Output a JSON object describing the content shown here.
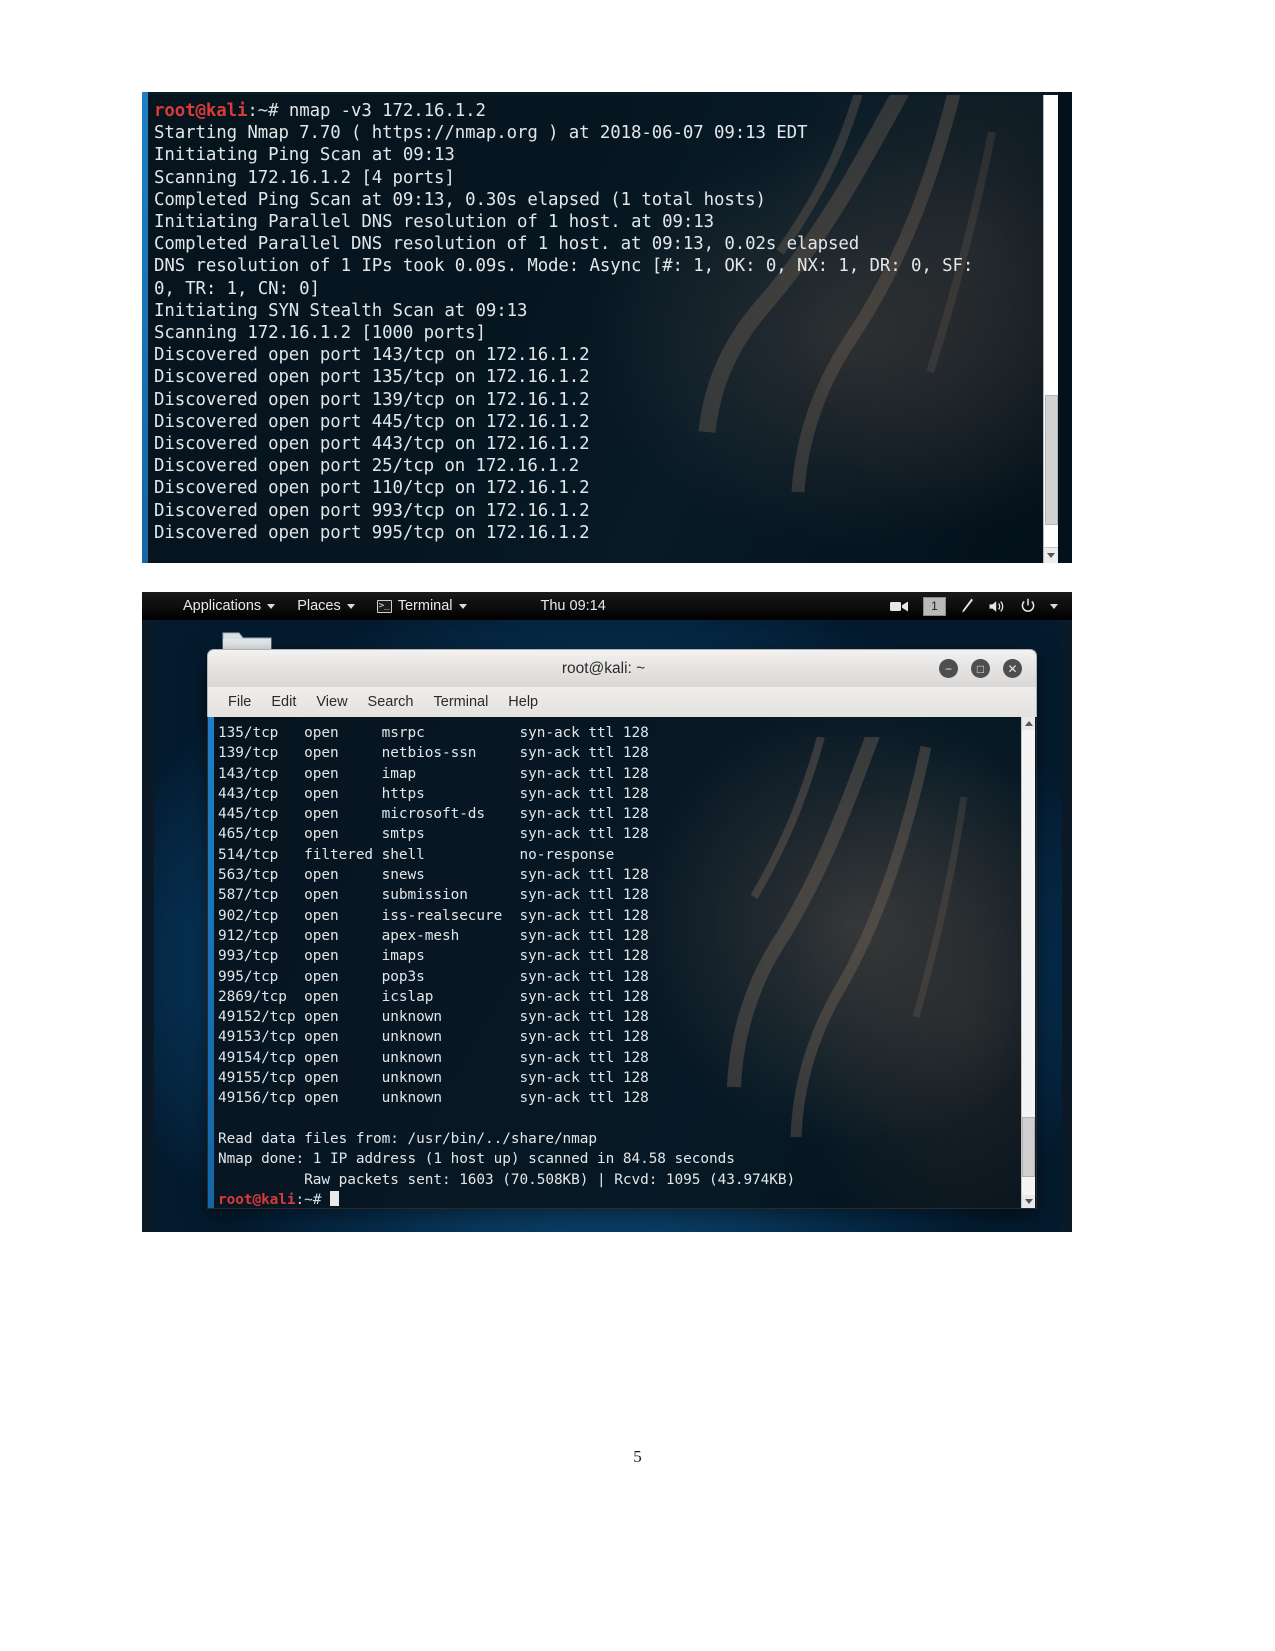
{
  "page": {
    "number": "5"
  },
  "screenshot1": {
    "name": "nmap-verbose-scan-output",
    "lines": [
      {
        "type": "prompt",
        "user": "root@kali",
        "path": ":~# ",
        "command": "nmap -v3 172.16.1.2"
      },
      {
        "type": "plain",
        "text": "Starting Nmap 7.70 ( https://nmap.org ) at 2018-06-07 09:13 EDT"
      },
      {
        "type": "plain",
        "text": "Initiating Ping Scan at 09:13"
      },
      {
        "type": "plain",
        "text": "Scanning 172.16.1.2 [4 ports]"
      },
      {
        "type": "plain",
        "text": "Completed Ping Scan at 09:13, 0.30s elapsed (1 total hosts)"
      },
      {
        "type": "plain",
        "text": "Initiating Parallel DNS resolution of 1 host. at 09:13"
      },
      {
        "type": "plain",
        "text": "Completed Parallel DNS resolution of 1 host. at 09:13, 0.02s elapsed"
      },
      {
        "type": "plain",
        "text": "DNS resolution of 1 IPs took 0.09s. Mode: Async [#: 1, OK: 0, NX: 1, DR: 0, SF:"
      },
      {
        "type": "plain",
        "text": "0, TR: 1, CN: 0]"
      },
      {
        "type": "plain",
        "text": "Initiating SYN Stealth Scan at 09:13"
      },
      {
        "type": "plain",
        "text": "Scanning 172.16.1.2 [1000 ports]"
      },
      {
        "type": "plain",
        "text": "Discovered open port 143/tcp on 172.16.1.2"
      },
      {
        "type": "plain",
        "text": "Discovered open port 135/tcp on 172.16.1.2"
      },
      {
        "type": "plain",
        "text": "Discovered open port 139/tcp on 172.16.1.2"
      },
      {
        "type": "plain",
        "text": "Discovered open port 445/tcp on 172.16.1.2"
      },
      {
        "type": "plain",
        "text": "Discovered open port 443/tcp on 172.16.1.2"
      },
      {
        "type": "plain",
        "text": "Discovered open port 25/tcp on 172.16.1.2"
      },
      {
        "type": "plain",
        "text": "Discovered open port 110/tcp on 172.16.1.2"
      },
      {
        "type": "plain",
        "text": "Discovered open port 993/tcp on 172.16.1.2"
      },
      {
        "type": "plain",
        "text": "Discovered open port 995/tcp on 172.16.1.2"
      }
    ]
  },
  "screenshot2": {
    "name": "kali-desktop-nmap-results",
    "panel": {
      "applications": "Applications",
      "places": "Places",
      "terminal": "Terminal",
      "clock": "Thu 09:14",
      "workspace": "1"
    },
    "window": {
      "title": "root@kali: ~",
      "menu": [
        "File",
        "Edit",
        "View",
        "Search",
        "Terminal",
        "Help"
      ],
      "minimize_label": "−",
      "maximize_label": "□",
      "close_label": "✕"
    },
    "ports_table": {
      "rows": [
        {
          "port": "135/tcp",
          "state": "open",
          "service": "msrpc",
          "reason": "syn-ack ttl 128"
        },
        {
          "port": "139/tcp",
          "state": "open",
          "service": "netbios-ssn",
          "reason": "syn-ack ttl 128"
        },
        {
          "port": "143/tcp",
          "state": "open",
          "service": "imap",
          "reason": "syn-ack ttl 128"
        },
        {
          "port": "443/tcp",
          "state": "open",
          "service": "https",
          "reason": "syn-ack ttl 128"
        },
        {
          "port": "445/tcp",
          "state": "open",
          "service": "microsoft-ds",
          "reason": "syn-ack ttl 128"
        },
        {
          "port": "465/tcp",
          "state": "open",
          "service": "smtps",
          "reason": "syn-ack ttl 128"
        },
        {
          "port": "514/tcp",
          "state": "filtered",
          "service": "shell",
          "reason": "no-response"
        },
        {
          "port": "563/tcp",
          "state": "open",
          "service": "snews",
          "reason": "syn-ack ttl 128"
        },
        {
          "port": "587/tcp",
          "state": "open",
          "service": "submission",
          "reason": "syn-ack ttl 128"
        },
        {
          "port": "902/tcp",
          "state": "open",
          "service": "iss-realsecure",
          "reason": "syn-ack ttl 128"
        },
        {
          "port": "912/tcp",
          "state": "open",
          "service": "apex-mesh",
          "reason": "syn-ack ttl 128"
        },
        {
          "port": "993/tcp",
          "state": "open",
          "service": "imaps",
          "reason": "syn-ack ttl 128"
        },
        {
          "port": "995/tcp",
          "state": "open",
          "service": "pop3s",
          "reason": "syn-ack ttl 128"
        },
        {
          "port": "2869/tcp",
          "state": "open",
          "service": "icslap",
          "reason": "syn-ack ttl 128"
        },
        {
          "port": "49152/tcp",
          "state": "open",
          "service": "unknown",
          "reason": "syn-ack ttl 128"
        },
        {
          "port": "49153/tcp",
          "state": "open",
          "service": "unknown",
          "reason": "syn-ack ttl 128"
        },
        {
          "port": "49154/tcp",
          "state": "open",
          "service": "unknown",
          "reason": "syn-ack ttl 128"
        },
        {
          "port": "49155/tcp",
          "state": "open",
          "service": "unknown",
          "reason": "syn-ack ttl 128"
        },
        {
          "port": "49156/tcp",
          "state": "open",
          "service": "unknown",
          "reason": "syn-ack ttl 128"
        }
      ]
    },
    "summary": [
      "Read data files from: /usr/bin/../share/nmap",
      "Nmap done: 1 IP address (1 host up) scanned in 84.58 seconds",
      "          Raw packets sent: 1603 (70.508KB) | Rcvd: 1095 (43.974KB)"
    ],
    "final_prompt": {
      "user": "root@kali",
      "path": ":~# "
    }
  }
}
